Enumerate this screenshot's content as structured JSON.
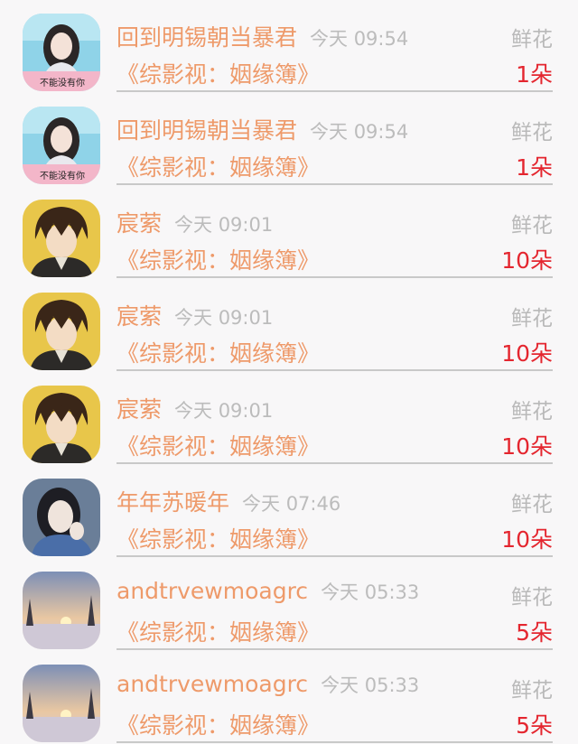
{
  "records": [
    {
      "user": "回到明锡朝当暴君",
      "time": "今天 09:54",
      "kind": "鲜花",
      "book": "《综影视：姻缘簿》",
      "count": "1朵",
      "avatar": "girl-pink-icon",
      "avatar_text": "不能没有你"
    },
    {
      "user": "回到明锡朝当暴君",
      "time": "今天 09:54",
      "kind": "鲜花",
      "book": "《综影视：姻缘簿》",
      "count": "1朵",
      "avatar": "girl-pink-icon",
      "avatar_text": "不能没有你"
    },
    {
      "user": "宸萦",
      "time": "今天 09:01",
      "kind": "鲜花",
      "book": "《综影视：姻缘簿》",
      "count": "10朵",
      "avatar": "anime-boy-icon"
    },
    {
      "user": "宸萦",
      "time": "今天 09:01",
      "kind": "鲜花",
      "book": "《综影视：姻缘簿》",
      "count": "10朵",
      "avatar": "anime-boy-icon"
    },
    {
      "user": "宸萦",
      "time": "今天 09:01",
      "kind": "鲜花",
      "book": "《综影视：姻缘簿》",
      "count": "10朵",
      "avatar": "anime-boy-icon"
    },
    {
      "user": "年年苏暖年",
      "time": "今天 07:46",
      "kind": "鲜花",
      "book": "《综影视：姻缘簿》",
      "count": "10朵",
      "avatar": "woman-portrait-icon"
    },
    {
      "user": "andtrvewmoagrc",
      "time": "今天 05:33",
      "kind": "鲜花",
      "book": "《综影视：姻缘簿》",
      "count": "5朵",
      "avatar": "winter-sunset-icon"
    },
    {
      "user": "andtrvewmoagrc",
      "time": "今天 05:33",
      "kind": "鲜花",
      "book": "《综影视：姻缘簿》",
      "count": "5朵",
      "avatar": "winter-sunset-icon"
    }
  ],
  "colors": {
    "accent": "#ee9a6a",
    "count": "#e4262f",
    "muted": "#bcbcbc",
    "background": "#f8f7f8"
  }
}
